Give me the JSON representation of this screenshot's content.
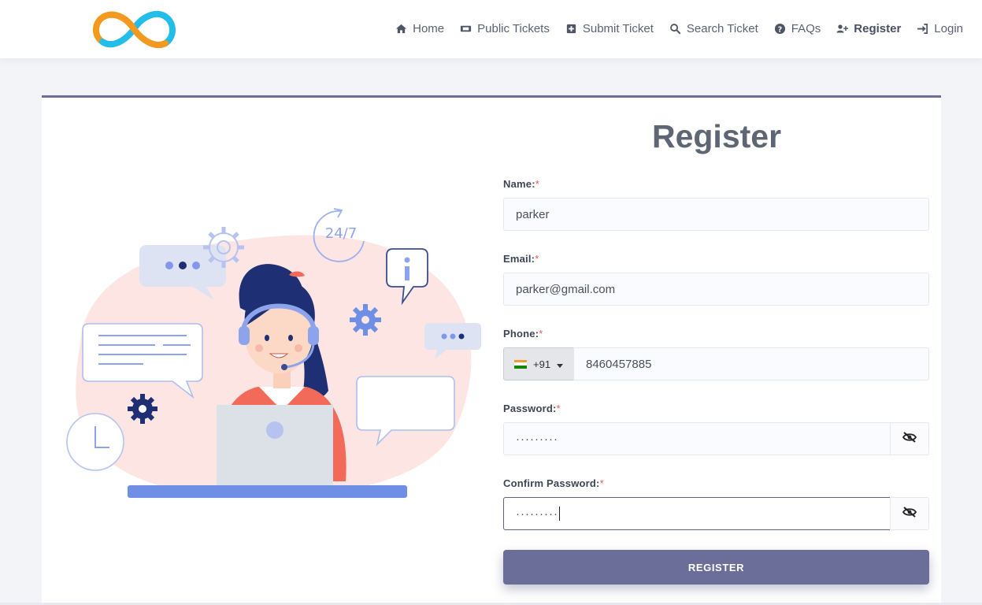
{
  "nav": {
    "items": [
      {
        "label": "Home",
        "icon": "home-icon"
      },
      {
        "label": "Public Tickets",
        "icon": "ticket-icon"
      },
      {
        "label": "Submit Ticket",
        "icon": "plus-square-icon"
      },
      {
        "label": "Search Ticket",
        "icon": "search-icon"
      },
      {
        "label": "FAQs",
        "icon": "question-circle-icon"
      },
      {
        "label": "Register",
        "icon": "user-plus-icon"
      },
      {
        "label": "Login",
        "icon": "sign-in-icon"
      }
    ]
  },
  "illustration": {
    "badge_text": "24/7"
  },
  "form": {
    "title": "Register",
    "required_mark": "*",
    "name": {
      "label": "Name:",
      "value": "parker"
    },
    "email": {
      "label": "Email:",
      "value": "parker@gmail.com"
    },
    "phone": {
      "label": "Phone:",
      "country_code": "+91",
      "value": "8460457885"
    },
    "password": {
      "label": "Password:",
      "value": "·········"
    },
    "confirm_password": {
      "label": "Confirm Password:",
      "value": "·········"
    },
    "submit_label": "REGISTER"
  },
  "colors": {
    "accent": "#6b6e99",
    "logo_blue": "#1fb8e8",
    "logo_orange": "#f29a1f",
    "required": "#e05a5a",
    "illustration_blob": "#fde5e3"
  }
}
